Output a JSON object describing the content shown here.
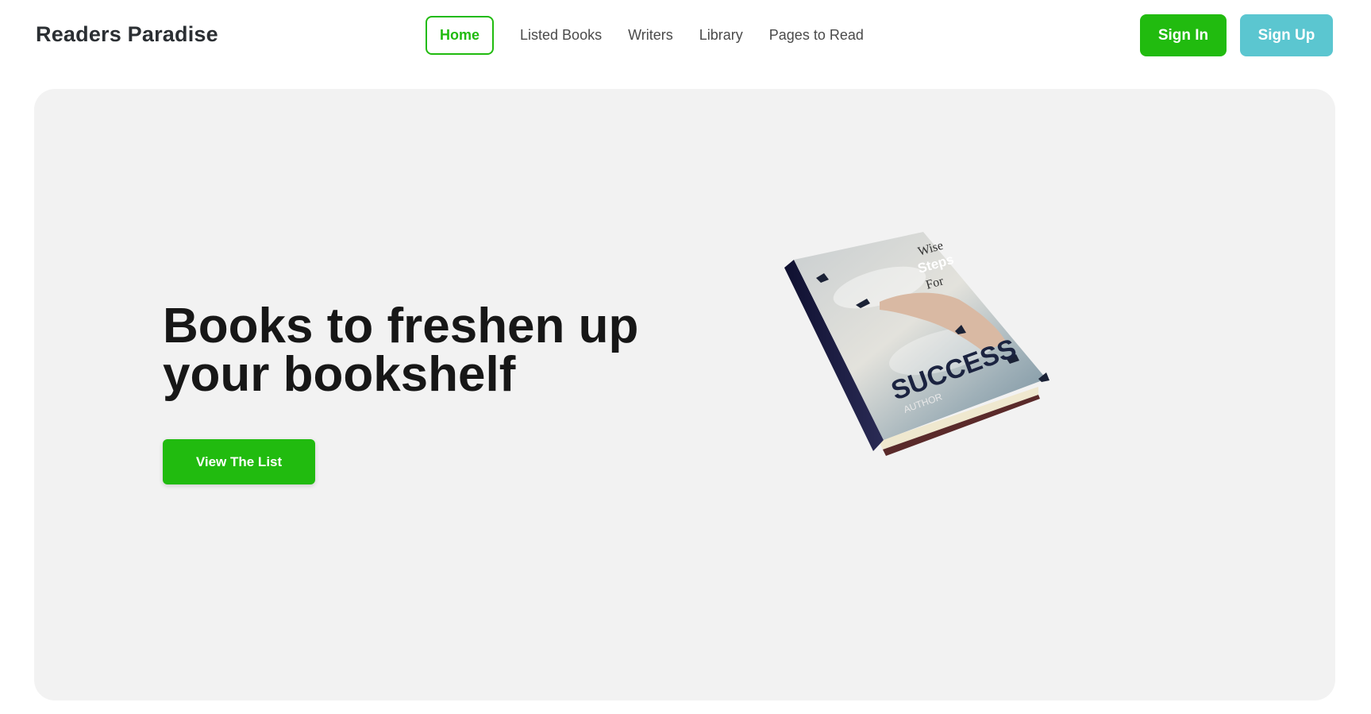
{
  "brand": "Readers Paradise",
  "nav": {
    "items": [
      {
        "label": "Home",
        "active": true
      },
      {
        "label": "Listed Books"
      },
      {
        "label": "Writers"
      },
      {
        "label": "Library"
      },
      {
        "label": "Pages to Read"
      }
    ]
  },
  "auth": {
    "signin_label": "Sign In",
    "signup_label": "Sign Up"
  },
  "hero": {
    "headline_line1": "Books to freshen up",
    "headline_line2": "your bookshelf",
    "cta_label": "View The List",
    "book_cover": {
      "title_word1": "Wise",
      "title_word2": "Steps",
      "title_word3": "For",
      "title_main": "SUCCESS",
      "author": "AUTHOR"
    }
  },
  "colors": {
    "accent_green": "#21bb0f",
    "signup_teal": "#5bc6d0",
    "hero_bg": "#f2f2f2"
  }
}
